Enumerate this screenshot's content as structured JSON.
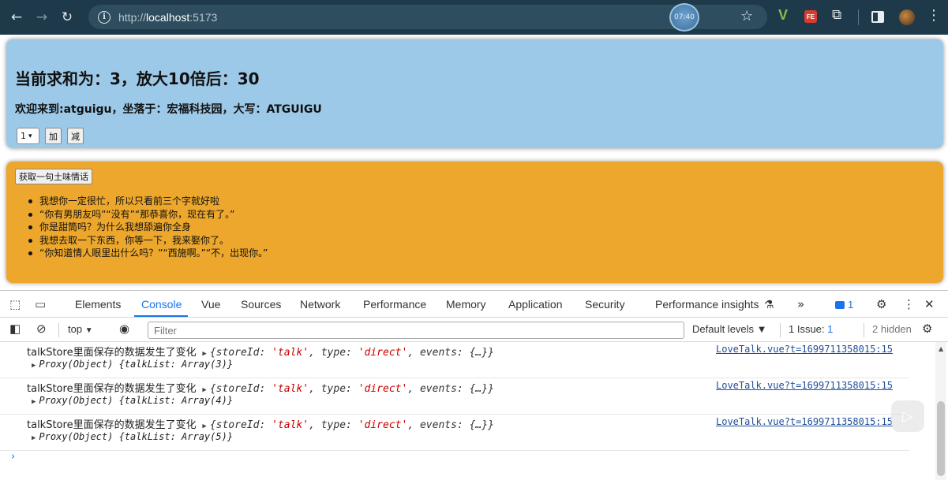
{
  "browser": {
    "url_scheme": "http://",
    "url_host": "localhost",
    "url_port": ":5173",
    "clock_badge": "07:40",
    "ext_fe": "FE",
    "ext_v": "V",
    "nav_back": "←",
    "nav_forward": "→",
    "nav_reload": "↻",
    "info": "i",
    "star": "☆",
    "puzzle": "⧉",
    "menu": "⋮"
  },
  "count_panel": {
    "sum_text": "当前求和为：3，放大10倍后：30",
    "school_text": "欢迎来到:atguigu，坐落于：宏福科技园，大写：ATGUIGU",
    "select_value": "1",
    "caret": "▾",
    "add_label": "加",
    "minus_label": "减"
  },
  "talk_panel": {
    "button_label": "获取一句土味情话",
    "items": [
      "我想你一定很忙，所以只看前三个字就好啦",
      "“你有男朋友吗”“没有”“那恭喜你，现在有了。”",
      "你是甜筒吗？为什么我想舔遍你全身",
      "我想去取一下东西，你等一下，我来娶你了。",
      "“你知道情人眼里出什么吗？”“西施啊。”“不，出现你。”"
    ]
  },
  "devtools": {
    "tabs": [
      "Elements",
      "Console",
      "Vue",
      "Sources",
      "Network",
      "Performance",
      "Memory",
      "Application",
      "Security",
      "Performance insights"
    ],
    "active_tab": "Console",
    "perf_flask": "⚗",
    "more_tabs": "»",
    "issue_count": "1",
    "settings_icon": "⚙",
    "kebab_icon": "⋮",
    "close_icon": "✕",
    "inspect_icon": "⬚",
    "device_icon": "▭",
    "filterbar": {
      "sidebar_icon": "◧",
      "clear_icon": "⊘",
      "context": "top",
      "context_caret": "▼",
      "eye_icon": "◉",
      "filter_placeholder": "Filter",
      "levels": "Default levels ▼",
      "issues_prefix": "1 Issue:",
      "issues_count": "1",
      "hidden": "2 hidden",
      "gear": "⚙"
    },
    "logs": [
      {
        "message": "talkStore里面保存的数据发生了变化",
        "obj_prefix": "{storeId: ",
        "store_id": "'talk'",
        "type_key": ", type: ",
        "type_val": "'direct'",
        "obj_suffix": ", events: {…}}",
        "proxy": "Proxy(Object) {talkList: Array(3)}",
        "source": "LoveTalk.vue?t=1699711358015:15"
      },
      {
        "message": "talkStore里面保存的数据发生了变化",
        "obj_prefix": "{storeId: ",
        "store_id": "'talk'",
        "type_key": ", type: ",
        "type_val": "'direct'",
        "obj_suffix": ", events: {…}}",
        "proxy": "Proxy(Object) {talkList: Array(4)}",
        "source": "LoveTalk.vue?t=1699711358015:15"
      },
      {
        "message": "talkStore里面保存的数据发生了变化",
        "obj_prefix": "{storeId: ",
        "store_id": "'talk'",
        "type_key": ", type: ",
        "type_val": "'direct'",
        "obj_suffix": ", events: {…}}",
        "proxy": "Proxy(Object) {talkList: Array(5)}",
        "source": "LoveTalk.vue?t=1699711358015:15"
      }
    ],
    "prompt": "›"
  },
  "colors": {
    "chrome_bg": "#1e3a4a",
    "blue_panel": "#9dc9e8",
    "orange_panel": "#eda72c",
    "devtools_accent": "#1a73e8"
  }
}
